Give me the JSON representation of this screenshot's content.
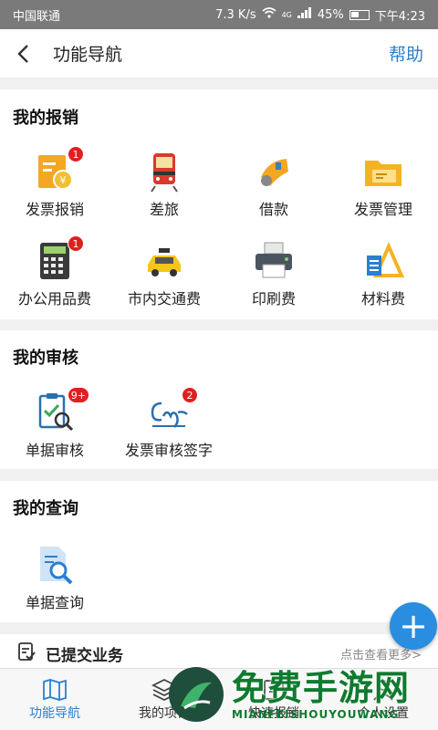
{
  "status": {
    "carrier": "中国联通",
    "speed": "7.3 K/s",
    "signal": "4G",
    "battery": "45%",
    "time": "下午4:23"
  },
  "header": {
    "title": "功能导航",
    "help": "帮助"
  },
  "reimburse": {
    "title": "我的报销",
    "items": [
      {
        "label": "发票报销",
        "badge": "1",
        "icon": "invoice-icon"
      },
      {
        "label": "差旅",
        "badge": "",
        "icon": "train-icon"
      },
      {
        "label": "借款",
        "badge": "",
        "icon": "loan-icon"
      },
      {
        "label": "发票管理",
        "badge": "",
        "icon": "folder-icon"
      },
      {
        "label": "办公用品费",
        "badge": "1",
        "icon": "calculator-icon"
      },
      {
        "label": "市内交通费",
        "badge": "",
        "icon": "taxi-icon"
      },
      {
        "label": "印刷费",
        "badge": "",
        "icon": "printer-icon"
      },
      {
        "label": "材料费",
        "badge": "",
        "icon": "materials-icon"
      }
    ]
  },
  "audit": {
    "title": "我的审核",
    "items": [
      {
        "label": "单据审核",
        "badge": "9+",
        "icon": "clipboard-check-icon"
      },
      {
        "label": "发票审核签字",
        "badge": "2",
        "icon": "signature-icon"
      }
    ]
  },
  "query": {
    "title": "我的查询",
    "items": [
      {
        "label": "单据查询",
        "icon": "document-search-icon"
      }
    ]
  },
  "submitted": {
    "title": "已提交业务",
    "more": "点击查看更多>"
  },
  "fab": {
    "label": "+"
  },
  "tabs": [
    {
      "label": "功能导航",
      "icon": "map-icon",
      "active": true
    },
    {
      "label": "我的项目",
      "icon": "layers-icon",
      "active": false
    },
    {
      "label": "快速报销",
      "icon": "quick-reimburse-icon",
      "active": false
    },
    {
      "label": "个人设置",
      "icon": "person-icon",
      "active": false
    }
  ],
  "watermark": {
    "text": "免费手游网",
    "sub": "MIANFEISHOUYOUWANG"
  },
  "colors": {
    "accent": "#2a7fd0",
    "badge": "#e02020",
    "fab": "#2a8ee0"
  }
}
